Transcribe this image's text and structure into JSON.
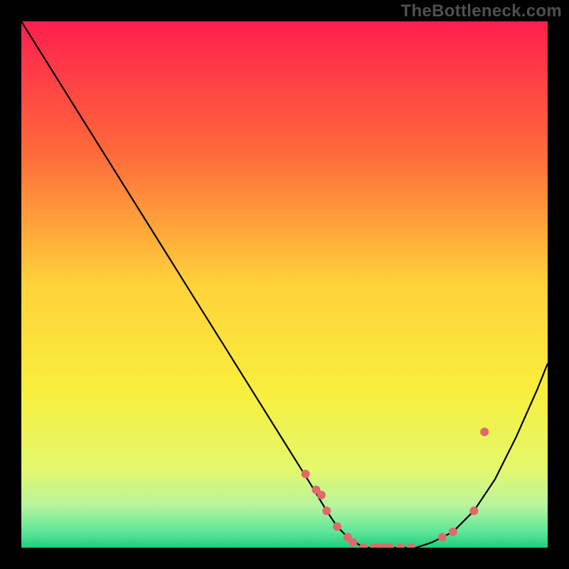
{
  "watermark": "TheBottleneck.com",
  "chart_data": {
    "type": "line",
    "title": "",
    "xlabel": "",
    "ylabel": "",
    "xlim": [
      0,
      100
    ],
    "ylim": [
      0,
      100
    ],
    "grid": false,
    "background_gradient": [
      {
        "pos": 0.0,
        "color": "#ff1f4e"
      },
      {
        "pos": 0.25,
        "color": "#ff6a3a"
      },
      {
        "pos": 0.5,
        "color": "#ffd23a"
      },
      {
        "pos": 0.7,
        "color": "#f8ee3c"
      },
      {
        "pos": 0.85,
        "color": "#e4f86c"
      },
      {
        "pos": 0.92,
        "color": "#b8f49c"
      },
      {
        "pos": 0.97,
        "color": "#5de69a"
      },
      {
        "pos": 1.0,
        "color": "#1dd07a"
      }
    ],
    "series": [
      {
        "name": "bottleneck-curve",
        "stroke": "#000000",
        "x": [
          0,
          5,
          10,
          15,
          20,
          25,
          30,
          35,
          40,
          45,
          50,
          55,
          58,
          60,
          62,
          65,
          68,
          70,
          72,
          75,
          78,
          82,
          86,
          90,
          94,
          98,
          100
        ],
        "values": [
          100,
          92,
          84,
          76,
          68,
          60,
          52,
          44,
          36,
          28,
          20,
          12,
          7,
          4,
          2,
          0,
          0,
          0,
          0,
          0,
          1,
          3,
          7,
          13,
          21,
          30,
          35
        ]
      }
    ],
    "scatter": [
      {
        "name": "curve-highlight-dots",
        "marker": "circle",
        "color": "#e06a6a",
        "radius": 6,
        "x": [
          54,
          56,
          57,
          58,
          60,
          62,
          63,
          65,
          67,
          68,
          69,
          70,
          72,
          74,
          80,
          82,
          86,
          88
        ],
        "values": [
          14,
          11,
          10,
          7,
          4,
          2,
          1,
          0,
          0,
          0,
          0,
          0,
          0,
          0,
          2,
          3,
          7,
          22
        ]
      }
    ]
  }
}
